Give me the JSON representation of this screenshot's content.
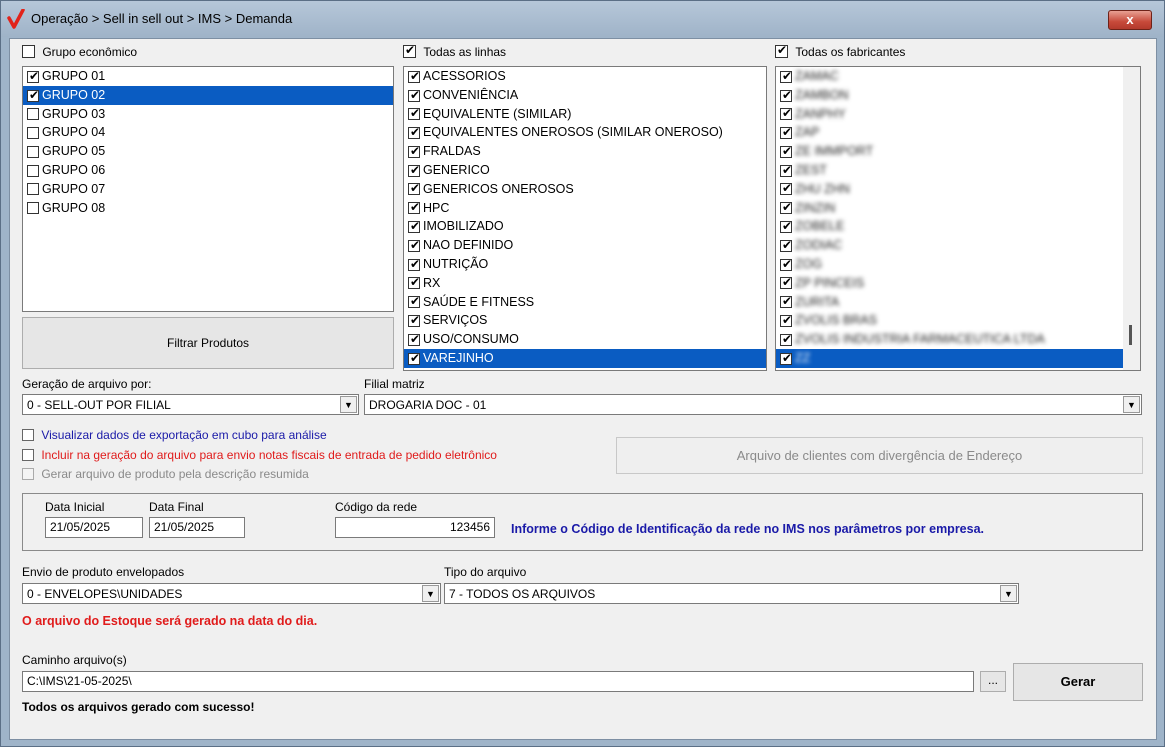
{
  "window": {
    "title": "Operação > Sell in sell out > IMS > Demanda",
    "close_label": "x",
    "logo_color": "#e2231a"
  },
  "grupo": {
    "header_label": "Grupo econômico",
    "header_checked": false,
    "items": [
      {
        "label": "GRUPO 01",
        "checked": true,
        "selected": false
      },
      {
        "label": "GRUPO 02",
        "checked": true,
        "selected": true
      },
      {
        "label": "GRUPO 03",
        "checked": false,
        "selected": false
      },
      {
        "label": "GRUPO 04",
        "checked": false,
        "selected": false
      },
      {
        "label": "GRUPO 05",
        "checked": false,
        "selected": false
      },
      {
        "label": "GRUPO 06",
        "checked": false,
        "selected": false
      },
      {
        "label": "GRUPO 07",
        "checked": false,
        "selected": false
      },
      {
        "label": "GRUPO 08",
        "checked": false,
        "selected": false
      }
    ]
  },
  "linhas": {
    "header_label": "Todas as linhas",
    "header_checked": true,
    "items": [
      {
        "label": "ACESSORIOS",
        "checked": true,
        "selected": false
      },
      {
        "label": "CONVENIÊNCIA",
        "checked": true,
        "selected": false
      },
      {
        "label": "EQUIVALENTE (SIMILAR)",
        "checked": true,
        "selected": false
      },
      {
        "label": "EQUIVALENTES ONEROSOS (SIMILAR ONEROSO)",
        "checked": true,
        "selected": false
      },
      {
        "label": "FRALDAS",
        "checked": true,
        "selected": false
      },
      {
        "label": "GENERICO",
        "checked": true,
        "selected": false
      },
      {
        "label": "GENERICOS ONEROSOS",
        "checked": true,
        "selected": false
      },
      {
        "label": "HPC",
        "checked": true,
        "selected": false
      },
      {
        "label": "IMOBILIZADO",
        "checked": true,
        "selected": false
      },
      {
        "label": "NAO DEFINIDO",
        "checked": true,
        "selected": false
      },
      {
        "label": "NUTRIÇÃO",
        "checked": true,
        "selected": false
      },
      {
        "label": "RX",
        "checked": true,
        "selected": false
      },
      {
        "label": "SAÚDE E FITNESS",
        "checked": true,
        "selected": false
      },
      {
        "label": "SERVIÇOS",
        "checked": true,
        "selected": false
      },
      {
        "label": "USO/CONSUMO",
        "checked": true,
        "selected": false
      },
      {
        "label": "VAREJINHO",
        "checked": true,
        "selected": true
      }
    ]
  },
  "fabricantes": {
    "header_label": "Todas os fabricantes",
    "header_checked": true,
    "items": [
      {
        "label": "ZAMAC",
        "checked": true,
        "selected": false
      },
      {
        "label": "ZAMBON",
        "checked": true,
        "selected": false
      },
      {
        "label": "ZANPHY",
        "checked": true,
        "selected": false
      },
      {
        "label": "ZAP",
        "checked": true,
        "selected": false
      },
      {
        "label": "ZE IMMPORT",
        "checked": true,
        "selected": false
      },
      {
        "label": "ZEST",
        "checked": true,
        "selected": false
      },
      {
        "label": "ZHU ZHN",
        "checked": true,
        "selected": false
      },
      {
        "label": "ZINZIN",
        "checked": true,
        "selected": false
      },
      {
        "label": "ZOBELE",
        "checked": true,
        "selected": false
      },
      {
        "label": "ZODIAC",
        "checked": true,
        "selected": false
      },
      {
        "label": "ZOG",
        "checked": true,
        "selected": false
      },
      {
        "label": "ZP PINCEIS",
        "checked": true,
        "selected": false
      },
      {
        "label": "ZURITA",
        "checked": true,
        "selected": false
      },
      {
        "label": "ZVOLIS BRAS",
        "checked": true,
        "selected": false
      },
      {
        "label": "ZVOLIS INDUSTRIA FARMACEUTICA LTDA",
        "checked": true,
        "selected": false
      },
      {
        "label": "ZZ",
        "checked": true,
        "selected": true
      }
    ]
  },
  "filtrar_label": "Filtrar Produtos",
  "geracao": {
    "label": "Geração de arquivo por:",
    "value": "0 - SELL-OUT POR FILIAL"
  },
  "filial": {
    "label": "Filial matriz",
    "value": "DROGARIA DOC - 01"
  },
  "options": {
    "visualizar": "Visualizar dados de exportação em cubo para análise",
    "incluir": "Incluir na geração do arquivo para envio notas fiscais de entrada de pedido eletrônico",
    "gerar_desc": "Gerar arquivo de produto pela descrição resumida"
  },
  "divergencia_label": "Arquivo de clientes com divergência de Endereço",
  "datas": {
    "inicial_label": "Data Inicial",
    "inicial_value": "21/05/2025",
    "final_label": "Data Final",
    "final_value": "21/05/2025",
    "codigo_label": "Código da rede",
    "codigo_value": "123456",
    "info_text": "Informe o Código de Identificação da rede no IMS nos parâmetros por empresa."
  },
  "envio": {
    "label": "Envio de produto envelopados",
    "value": "0 - ENVELOPES\\UNIDADES"
  },
  "tipo": {
    "label": "Tipo do arquivo",
    "value": "7 - TODOS OS ARQUIVOS"
  },
  "estoque_warning": "O arquivo do Estoque será gerado na data do dia.",
  "caminho": {
    "label": "Caminho arquivo(s)",
    "value": "C:\\IMS\\21-05-2025\\",
    "browse_label": "..."
  },
  "gerar_label": "Gerar",
  "status_text": "Todos os arquivos gerado com sucesso!",
  "colors": {
    "selection": "#0a5cc2",
    "info_blue": "#1a1aa8",
    "warning_red": "#e01b1b"
  }
}
